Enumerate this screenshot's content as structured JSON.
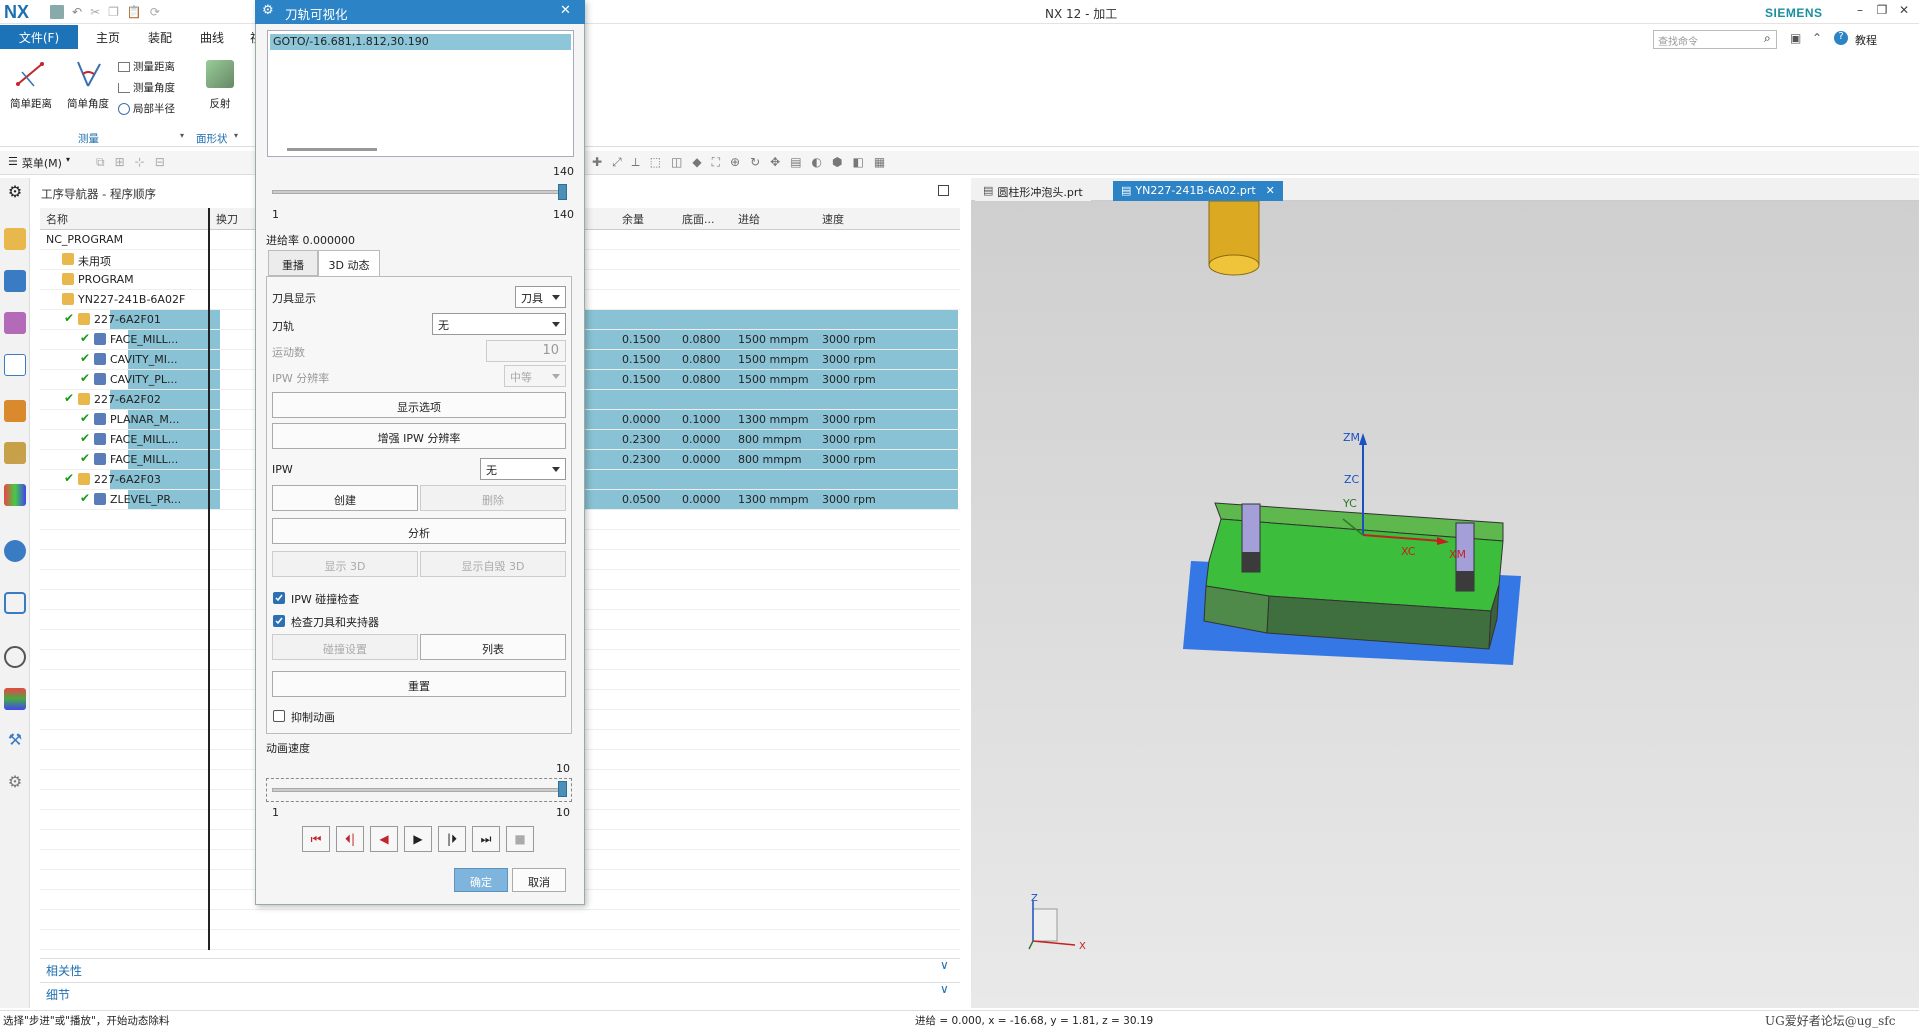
{
  "window": {
    "logo": "NX",
    "title": "NX 12 - 加工",
    "brand": "SIEMENS"
  },
  "ribbon": {
    "tabs": [
      "文件(F)",
      "主页",
      "装配",
      "曲线",
      "视"
    ],
    "big_tools": [
      "简单距离",
      "简单角度",
      "反射"
    ],
    "small_tools": [
      "测量距离",
      "测量角度",
      "局部半径"
    ],
    "groups": [
      "测量",
      "面形状"
    ],
    "search_placeholder": "查找命令",
    "help_label": "教程",
    "menu_label": "菜单(M)"
  },
  "navigator": {
    "title": "工序导航器 - 程序顺序",
    "columns": [
      "名称",
      "换刀",
      "余量",
      "底面...",
      "进给",
      "速度"
    ],
    "rows": [
      {
        "name": "NC_PROGRAM",
        "level": 0,
        "sel": false,
        "yu": "",
        "di": "",
        "feed": "",
        "speed": ""
      },
      {
        "name": "未用项",
        "level": 1,
        "sel": false,
        "yu": "",
        "di": "",
        "feed": "",
        "speed": ""
      },
      {
        "name": "PROGRAM",
        "level": 1,
        "sel": false,
        "yu": "",
        "di": "",
        "feed": "",
        "speed": ""
      },
      {
        "name": "YN227-241B-6A02F",
        "level": 1,
        "sel": false,
        "yu": "",
        "di": "",
        "feed": "",
        "speed": ""
      },
      {
        "name": "227-6A2F01",
        "level": 2,
        "sel": true,
        "yu": "",
        "di": "",
        "feed": "",
        "speed": ""
      },
      {
        "name": "FACE_MILL...",
        "level": 3,
        "sel": true,
        "yu": "0.1500",
        "di": "0.0800",
        "feed": "1500 mmpm",
        "speed": "3000 rpm"
      },
      {
        "name": "CAVITY_MI...",
        "level": 3,
        "sel": true,
        "yu": "0.1500",
        "di": "0.0800",
        "feed": "1500 mmpm",
        "speed": "3000 rpm"
      },
      {
        "name": "CAVITY_PL...",
        "level": 3,
        "sel": true,
        "yu": "0.1500",
        "di": "0.0800",
        "feed": "1500 mmpm",
        "speed": "3000 rpm"
      },
      {
        "name": "227-6A2F02",
        "level": 2,
        "sel": true,
        "yu": "",
        "di": "",
        "feed": "",
        "speed": ""
      },
      {
        "name": "PLANAR_M...",
        "level": 3,
        "sel": true,
        "yu": "0.0000",
        "di": "0.1000",
        "feed": "1300 mmpm",
        "speed": "3000 rpm"
      },
      {
        "name": "FACE_MILL...",
        "level": 3,
        "sel": true,
        "yu": "0.2300",
        "di": "0.0000",
        "feed": "800 mmpm",
        "speed": "3000 rpm"
      },
      {
        "name": "FACE_MILL...",
        "level": 3,
        "sel": true,
        "yu": "0.2300",
        "di": "0.0000",
        "feed": "800 mmpm",
        "speed": "3000 rpm"
      },
      {
        "name": "227-6A2F03",
        "level": 2,
        "sel": true,
        "yu": "",
        "di": "",
        "feed": "",
        "speed": ""
      },
      {
        "name": "ZLEVEL_PR...",
        "level": 3,
        "sel": true,
        "yu": "0.0500",
        "di": "0.0000",
        "feed": "1300 mmpm",
        "speed": "3000 rpm"
      }
    ],
    "relations_label": "相关性",
    "details_label": "细节"
  },
  "viewport": {
    "tabs": [
      "圆柱形冲泡头.prt",
      "YN227-241B-6A02.prt"
    ],
    "axis_labels": {
      "zm": "ZM",
      "zc": "ZC",
      "yc": "YC",
      "xc": "XC",
      "xm": "XM",
      "z": "Z",
      "x": "X"
    }
  },
  "dialog": {
    "title": "刀轨可视化",
    "list_item": "GOTO/-16.681,1.812,30.190",
    "slider1_max": "140",
    "slider1_min": "1",
    "slider1_right": "140",
    "feed_rate": "进给率 0.000000",
    "tabs": [
      "重播",
      "3D 动态"
    ],
    "tool_display_label": "刀具显示",
    "tool_display_value": "刀具",
    "toolpath_label": "刀轨",
    "toolpath_value": "无",
    "motion_count_label": "运动数",
    "motion_count_value": "10",
    "ipw_res_label": "IPW 分辨率",
    "ipw_res_value": "中等",
    "btn_display_options": "显示选项",
    "btn_enhance_ipw": "增强 IPW 分辨率",
    "ipw_label": "IPW",
    "ipw_value": "无",
    "btn_create": "创建",
    "btn_delete": "删除",
    "btn_analyze": "分析",
    "btn_show3d": "显示 3D",
    "btn_show_blank3d": "显示自毁 3D",
    "chk_ipw_collision": "IPW 碰撞检查",
    "chk_tool_holder": "检查刀具和夹持器",
    "btn_collision_settings": "碰撞设置",
    "btn_list": "列表",
    "btn_reset": "重置",
    "chk_suppress_anim": "抑制动画",
    "anim_speed_label": "动画速度",
    "anim_speed_value": 10,
    "anim_max": "10",
    "anim_min": "1",
    "anim_right": "10",
    "btn_ok": "确定",
    "btn_cancel": "取消",
    "colors": {
      "title": "#2c84c7",
      "selection": "#8cc6d8"
    }
  },
  "status": {
    "left": "选择\"步进\"或\"播放\"，开始动态除料",
    "right": "进给 = 0.000, x = -16.68, y = 1.81, z = 30.19",
    "watermark": "UG爱好者论坛@ug_sfc"
  }
}
